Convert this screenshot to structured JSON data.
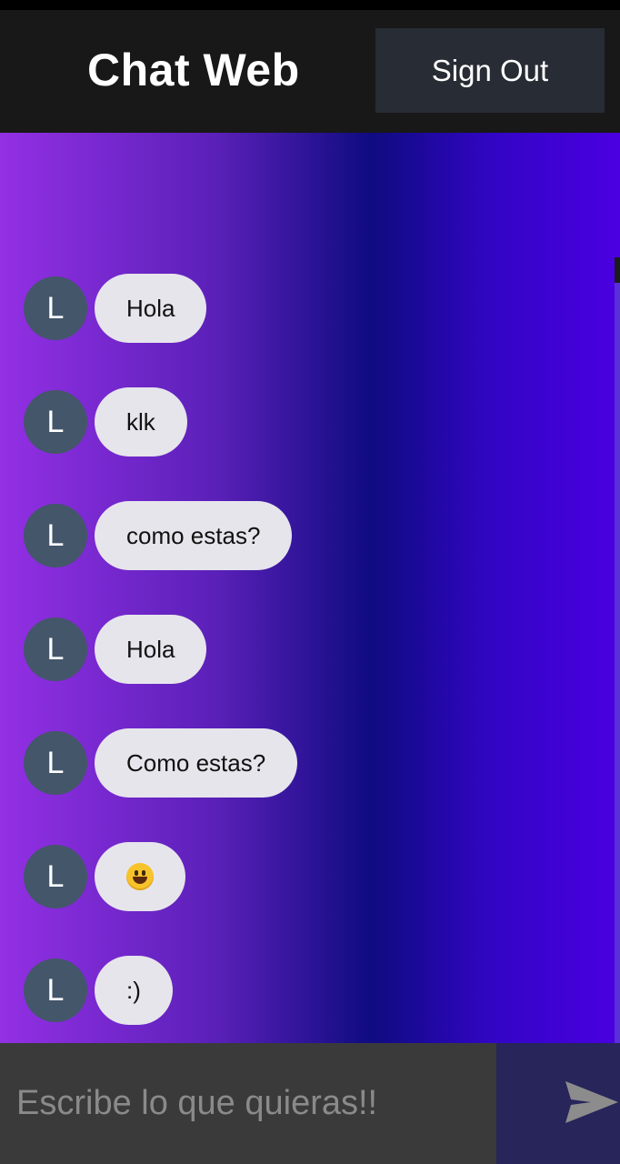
{
  "header": {
    "title": "Chat Web",
    "signout_label": "Sign Out"
  },
  "messages": [
    {
      "avatar": "L",
      "text": "Hola"
    },
    {
      "avatar": "L",
      "text": "klk"
    },
    {
      "avatar": "L",
      "text": "como estas?"
    },
    {
      "avatar": "L",
      "text": "Hola"
    },
    {
      "avatar": "L",
      "text": "Como estas?"
    },
    {
      "avatar": "L",
      "text": "😀",
      "icon": "grinning-face-emoji"
    },
    {
      "avatar": "L",
      "text": ":)"
    }
  ],
  "composer": {
    "placeholder": "Escribe lo que quieras!!",
    "value": "",
    "send_icon": "send-icon"
  },
  "colors": {
    "header_bg": "#181818",
    "signout_bg": "#282c34",
    "avatar_bg": "#44566a",
    "bubble_bg": "#e6e5ec",
    "composer_bg": "#3a3a3a",
    "send_bg": "#27255a",
    "gradient": [
      "#9330e4",
      "#0f0b80",
      "#4a00e0"
    ]
  }
}
